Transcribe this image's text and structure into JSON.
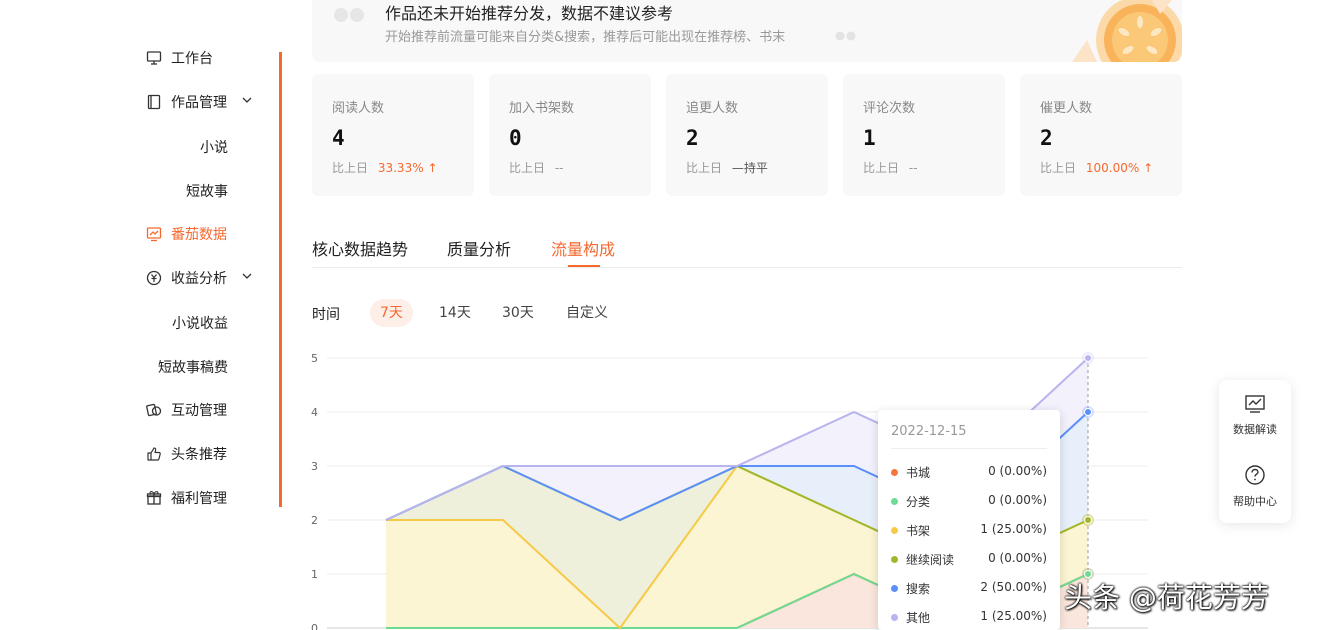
{
  "sidebar": {
    "items": [
      {
        "label": "工作台",
        "icon": "monitor-icon"
      },
      {
        "label": "作品管理",
        "icon": "book-icon"
      },
      {
        "label": "小说"
      },
      {
        "label": "短故事"
      },
      {
        "label": "番茄数据",
        "icon": "chart-screen-icon"
      },
      {
        "label": "收益分析",
        "icon": "yen-coin-icon"
      },
      {
        "label": "小说收益"
      },
      {
        "label": "短故事稿费"
      },
      {
        "label": "互动管理",
        "icon": "interact-icon"
      },
      {
        "label": "头条推荐",
        "icon": "thumbs-up-icon"
      },
      {
        "label": "福利管理",
        "icon": "gift-icon"
      }
    ],
    "accent_color": "#f5692f"
  },
  "banner": {
    "title": "作品还未开始推荐分发，数据不建议参考",
    "subtitle": "开始推荐前流量可能来自分类&搜索，推荐后可能出现在推荐榜、书末"
  },
  "stats": [
    {
      "label": "阅读人数",
      "value": "4",
      "cmp_label": "比上日",
      "cmp_value": "33.33%",
      "trend": "up"
    },
    {
      "label": "加入书架数",
      "value": "0",
      "cmp_label": "比上日",
      "cmp_value": "--",
      "trend": "none"
    },
    {
      "label": "追更人数",
      "value": "2",
      "cmp_label": "比上日",
      "cmp_value": "持平",
      "trend": "flat"
    },
    {
      "label": "评论次数",
      "value": "1",
      "cmp_label": "比上日",
      "cmp_value": "--",
      "trend": "none"
    },
    {
      "label": "催更人数",
      "value": "2",
      "cmp_label": "比上日",
      "cmp_value": "100.00%",
      "trend": "up"
    }
  ],
  "tabs": [
    "核心数据趋势",
    "质量分析",
    "流量构成"
  ],
  "active_tab": "流量构成",
  "range": {
    "label": "时间",
    "options": [
      "7天",
      "14天",
      "30天",
      "自定义"
    ],
    "selected": "7天"
  },
  "chart_data": {
    "type": "area",
    "stacked": true,
    "ylim": [
      0,
      5
    ],
    "yticks": [
      0,
      1,
      2,
      3,
      4,
      5
    ],
    "points": 7,
    "x": [
      "",
      "",
      "",
      "",
      "",
      "",
      "2022-12-15"
    ],
    "series": [
      {
        "name": "书城",
        "color": "#f5773f",
        "values": [
          0,
          0,
          0,
          0,
          1,
          0,
          1
        ]
      },
      {
        "name": "分类",
        "color": "#6ddb94",
        "values": [
          0,
          0,
          0,
          0,
          0,
          0,
          0
        ]
      },
      {
        "name": "书架",
        "color": "#f7c948",
        "values": [
          2,
          2,
          0,
          3,
          1,
          1,
          1
        ]
      },
      {
        "name": "继续阅读",
        "color": "#a0b82e",
        "values": [
          0,
          1,
          2,
          0,
          0,
          0,
          0
        ]
      },
      {
        "name": "搜索",
        "color": "#5b8ff9",
        "values": [
          0,
          0,
          0,
          0,
          1,
          1,
          2
        ]
      },
      {
        "name": "其他",
        "color": "#b8b4ef",
        "values": [
          0,
          0,
          1,
          0,
          1,
          1,
          1
        ]
      }
    ]
  },
  "tooltip": {
    "date": "2022-12-15",
    "rows": [
      {
        "name": "书城",
        "value": "0 (0.00%)",
        "color": "#f5773f"
      },
      {
        "name": "分类",
        "value": "0 (0.00%)",
        "color": "#6ddb94"
      },
      {
        "name": "书架",
        "value": "1 (25.00%)",
        "color": "#f7c948"
      },
      {
        "name": "继续阅读",
        "value": "0 (0.00%)",
        "color": "#a0b82e"
      },
      {
        "name": "搜索",
        "value": "2 (50.00%)",
        "color": "#5b8ff9"
      },
      {
        "name": "其他",
        "value": "1 (25.00%)",
        "color": "#b8b4ef"
      }
    ]
  },
  "float_panel": [
    {
      "label": "数据解读",
      "icon": "line-chart-icon"
    },
    {
      "label": "帮助中心",
      "icon": "help-circle-icon"
    }
  ],
  "watermark": "头条 @荷花芳芳"
}
